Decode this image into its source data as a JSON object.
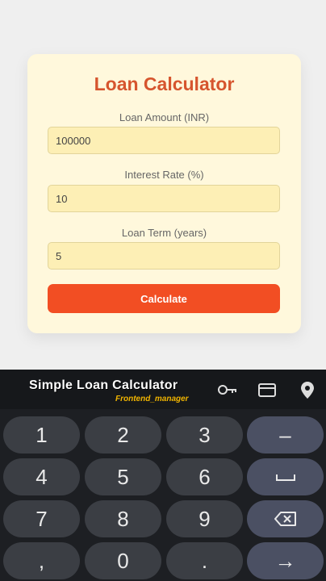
{
  "card": {
    "title": "Loan Calculator",
    "amount_label": "Loan Amount (INR)",
    "amount_value": "100000",
    "rate_label": "Interest Rate (%)",
    "rate_value": "10",
    "term_label": "Loan Term (years)",
    "term_value": "5",
    "calculate_label": "Calculate"
  },
  "keyboard": {
    "brand": "Simple Loan Calculator",
    "brand_sub": "Frontend_manager",
    "toolbar_icons": [
      "key-icon",
      "credit-card-icon",
      "location-pin-icon"
    ],
    "keys": {
      "k1": "1",
      "k2": "2",
      "k3": "3",
      "minus": "–",
      "k4": "4",
      "k5": "5",
      "k6": "6",
      "k7": "7",
      "k8": "8",
      "k9": "9",
      "comma": ",",
      "k0": "0",
      "dot": ".",
      "enter": "→"
    }
  }
}
